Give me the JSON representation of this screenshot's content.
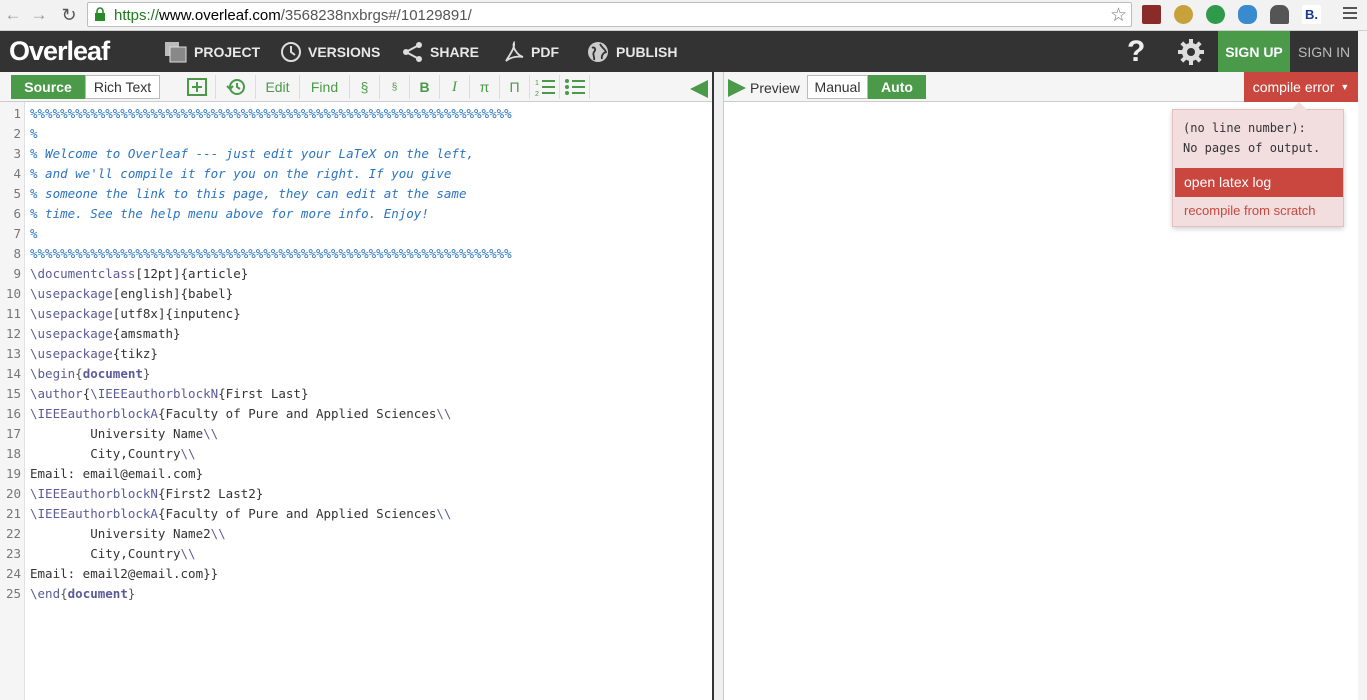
{
  "browser": {
    "url_scheme": "https://",
    "url_host": "www.overleaf.com",
    "url_path": "/3568238nxbrgs#/10129891/"
  },
  "header": {
    "logo": "Overleaf",
    "nav": [
      {
        "label": "PROJECT",
        "icon": "project-icon"
      },
      {
        "label": "VERSIONS",
        "icon": "versions-icon"
      },
      {
        "label": "SHARE",
        "icon": "share-icon"
      },
      {
        "label": "PDF",
        "icon": "pdf-icon"
      },
      {
        "label": "PUBLISH",
        "icon": "globe-icon"
      }
    ],
    "help": "?",
    "signup": "SIGN UP",
    "signin": "SIGN IN"
  },
  "editor_toolbar": {
    "source": "Source",
    "rich_text": "Rich Text",
    "edit": "Edit",
    "find": "Find",
    "section": "§",
    "subsection": "§",
    "bold": "B",
    "italic": "I",
    "pi": "π",
    "Pi": "Π"
  },
  "preview_toolbar": {
    "preview": "Preview",
    "manual": "Manual",
    "auto": "Auto",
    "compile_error": "compile error"
  },
  "dropdown": {
    "message_line1": "(no line number):",
    "message_line2": "No pages of output.",
    "open_log": "open latex log",
    "recompile": "recompile from scratch"
  },
  "code_lines": [
    "%%%%%%%%%%%%%%%%%%%%%%%%%%%%%%%%%%%%%%%%%%%%%%%%%%%%%%%%%%%%%%%%",
    "%",
    "% Welcome to Overleaf --- just edit your LaTeX on the left,",
    "% and we'll compile it for you on the right. If you give",
    "% someone the link to this page, they can edit at the same",
    "% time. See the help menu above for more info. Enjoy!",
    "%",
    "%%%%%%%%%%%%%%%%%%%%%%%%%%%%%%%%%%%%%%%%%%%%%%%%%%%%%%%%%%%%%%%%",
    "\\documentclass[12pt]{article}",
    "\\usepackage[english]{babel}",
    "\\usepackage[utf8x]{inputenc}",
    "\\usepackage{amsmath}",
    "\\usepackage{tikz}",
    "\\begin{document}",
    "\\author{\\IEEEauthorblockN{First Last}",
    "\\IEEEauthorblockA{Faculty of Pure and Applied Sciences\\\\",
    "        University Name\\\\",
    "        City,Country\\\\",
    "Email: email@email.com}",
    "\\IEEEauthorblockN{First2 Last2}",
    "\\IEEEauthorblockA{Faculty of Pure and Applied Sciences\\\\",
    "        University Name2\\\\",
    "        City,Country\\\\",
    "Email: email2@email.com}}",
    "\\end{document}"
  ],
  "colors": {
    "accent_green": "#4a9a4a",
    "error_red": "#c9473f",
    "header_bg": "#333333",
    "comment_blue": "#2a74c4"
  }
}
